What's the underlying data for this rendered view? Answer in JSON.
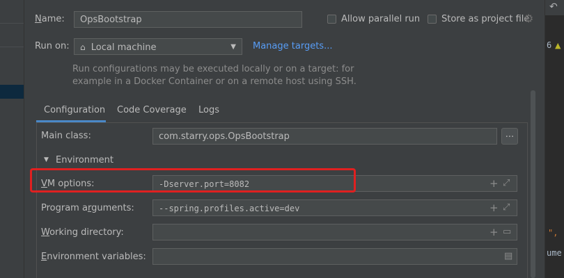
{
  "form": {
    "name_label": "Name:",
    "name_value": "OpsBootstrap",
    "allow_parallel_label": "Allow parallel run",
    "store_project_label": "Store as project file",
    "run_on_label": "Run on:",
    "run_on_value": "Local machine",
    "manage_targets_label": "Manage targets...",
    "hint_line1": "Run configurations may be executed locally or on a target: for",
    "hint_line2": "example in a Docker Container or on a remote host using SSH."
  },
  "tabs": [
    {
      "label": "Configuration",
      "active": true
    },
    {
      "label": "Code Coverage",
      "active": false
    },
    {
      "label": "Logs",
      "active": false
    }
  ],
  "config": {
    "main_class_label": "Main class:",
    "main_class_value": "com.starry.ops.OpsBootstrap",
    "browse_label": "...",
    "environment_label": "Environment",
    "vm_options_label": "VM options:",
    "vm_options_value": "-Dserver.port=8082",
    "program_args_label": "Program arguments:",
    "program_args_value": "--spring.profiles.active=dev",
    "working_dir_label": "Working directory:",
    "working_dir_value": "",
    "env_vars_label": "Environment variables:",
    "env_vars_value": ""
  },
  "editor_fragments": {
    "top": "6",
    "mid": "\",",
    "bottom": "ume"
  },
  "colors": {
    "background": "#3c3f41",
    "field": "#45494a",
    "link": "#589df6",
    "highlight": "#e02020",
    "tab_underline": "#4a88c7"
  }
}
